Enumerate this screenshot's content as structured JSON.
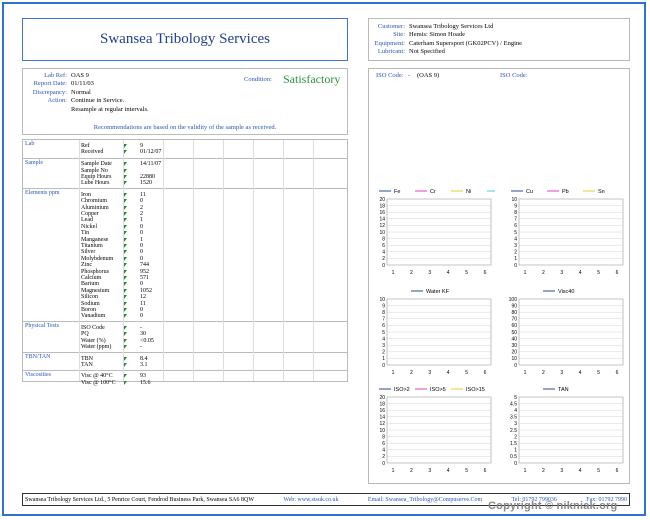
{
  "header": {
    "title": "Swansea Tribology Services"
  },
  "customer_info": [
    {
      "key": "Customer:",
      "value": "Swansea Tribology Services Ltd"
    },
    {
      "key": "Site:",
      "value": "Hemis: Simon Hoade"
    },
    {
      "key": "Equipment:",
      "value": "Caterham Supersport (GK02PCV) / Engine"
    },
    {
      "key": "Lubricant:",
      "value": "Not Specified"
    }
  ],
  "report": {
    "fields": [
      {
        "key": "Lab Ref:",
        "value": "OAS 9"
      },
      {
        "key": "Report Date:",
        "value": "01/11/03"
      },
      {
        "key": "Discrepancy:",
        "value": "Normal"
      },
      {
        "key": "Action:",
        "value": "Continue in Service."
      },
      {
        "key": "",
        "value": "Resample at regular intervals."
      }
    ],
    "condition_label": "Condition:",
    "condition_value": "Satisfactory",
    "recommendation_note": "Recommendations are based on the validity of the sample as received."
  },
  "sections": [
    {
      "label": "Lab",
      "rows": [
        [
          "Ref",
          "9"
        ],
        [
          "Received",
          "01/12/07"
        ]
      ]
    },
    {
      "label": "Sample",
      "rows": [
        [
          "Sample Date",
          "14/11/07"
        ],
        [
          "Sample No",
          ""
        ],
        [
          "Equip Hours",
          "22880"
        ],
        [
          "Lube Hours",
          "1520"
        ]
      ]
    },
    {
      "label": "Elements ppm",
      "rows": [
        [
          "Iron",
          "11"
        ],
        [
          "Chromium",
          "0"
        ],
        [
          "Aluminium",
          "2"
        ],
        [
          "Copper",
          "2"
        ],
        [
          "Lead",
          "1"
        ],
        [
          "Nickel",
          "0"
        ],
        [
          "Tin",
          "0"
        ],
        [
          "Manganese",
          "1"
        ],
        [
          "Titanium",
          "0"
        ],
        [
          "Silver",
          "0"
        ],
        [
          "Molybdenum",
          "0"
        ],
        [
          "Zinc",
          "744"
        ],
        [
          "Phosphorus",
          "952"
        ],
        [
          "Calcium",
          "571"
        ],
        [
          "Barium",
          "0"
        ],
        [
          "Magnesium",
          "1052"
        ],
        [
          "Silicon",
          "12"
        ],
        [
          "Sodium",
          "11"
        ],
        [
          "Boron",
          "0"
        ],
        [
          "Vanadium",
          "0"
        ]
      ]
    },
    {
      "label": "Physical Tests",
      "rows": [
        [
          "ISO Code",
          "-"
        ],
        [
          "PQ",
          "30"
        ],
        [
          "Water (%)",
          "<0.05"
        ],
        [
          "Water (ppm)",
          "-"
        ]
      ]
    },
    {
      "label": "TBN/TAN",
      "rows": [
        [
          "TBN",
          "8.4"
        ],
        [
          "TAN",
          "3.1"
        ]
      ]
    },
    {
      "label": "Viscosities",
      "rows": [
        [
          "Visc @ 40°C",
          "93"
        ],
        [
          "Visc @ 100°C",
          "15.6"
        ]
      ]
    }
  ],
  "iso_codes": [
    {
      "label": "ISO Code:",
      "value": "-",
      "extra": "(OAS 9)"
    },
    {
      "label": "ISO Code:",
      "value": "",
      "extra": ""
    }
  ],
  "colors": {
    "fe": "#2b4a9c",
    "cr": "#e23fd0",
    "ni": "#e0d030",
    "si": "#3fd0e0",
    "cu": "#2b4a9c",
    "pb": "#e23fd0",
    "sn": "#e0d030",
    "water": "#2b4a9c",
    "visc": "#2b4a9c",
    "iso2": "#2b4a9c",
    "iso5": "#e23fd0",
    "iso15": "#e0d030",
    "tan": "#2b4a9c"
  },
  "chart_data": [
    {
      "type": "line",
      "series": [
        {
          "name": "Fe",
          "values": []
        },
        {
          "name": "Cr",
          "values": []
        },
        {
          "name": "Ni",
          "values": []
        },
        {
          "name": "Si",
          "values": []
        }
      ],
      "x": [
        1,
        2,
        3,
        4,
        5,
        6
      ],
      "ylim": [
        0,
        20
      ],
      "yticks": [
        0,
        2,
        4,
        6,
        8,
        10,
        12,
        14,
        16,
        18,
        20
      ]
    },
    {
      "type": "line",
      "series": [
        {
          "name": "Cu",
          "values": []
        },
        {
          "name": "Pb",
          "values": []
        },
        {
          "name": "Sn",
          "values": []
        }
      ],
      "x": [
        1,
        2,
        3,
        4,
        5,
        6
      ],
      "ylim": [
        0,
        10
      ],
      "yticks": [
        0,
        1,
        2,
        3,
        4,
        5,
        6,
        7,
        8,
        9,
        10
      ]
    },
    {
      "type": "line",
      "series": [
        {
          "name": "Water KF",
          "values": []
        }
      ],
      "x": [
        1,
        2,
        3,
        4,
        5,
        6
      ],
      "ylim": [
        0,
        10
      ],
      "yticks": [
        0,
        1,
        2,
        3,
        4,
        5,
        6,
        7,
        8,
        9,
        10
      ]
    },
    {
      "type": "line",
      "series": [
        {
          "name": "Visc40",
          "values": []
        }
      ],
      "x": [
        1,
        2,
        3,
        4,
        5,
        6
      ],
      "ylim": [
        0,
        100
      ],
      "yticks": [
        0,
        10,
        20,
        30,
        40,
        50,
        60,
        70,
        80,
        90,
        100
      ]
    },
    {
      "type": "line",
      "series": [
        {
          "name": "ISO>2",
          "values": []
        },
        {
          "name": "ISO>5",
          "values": []
        },
        {
          "name": "ISO>15",
          "values": []
        }
      ],
      "x": [
        1,
        2,
        3,
        4,
        5,
        6
      ],
      "ylim": [
        0,
        20
      ],
      "yticks": [
        0,
        2,
        4,
        6,
        8,
        10,
        12,
        14,
        16,
        18,
        20
      ]
    },
    {
      "type": "line",
      "series": [
        {
          "name": "TAN",
          "values": []
        }
      ],
      "x": [
        1,
        2,
        3,
        4,
        5,
        6
      ],
      "ylim": [
        0,
        5
      ],
      "yticks": [
        0,
        0.5,
        1,
        1.5,
        2,
        2.5,
        3,
        3.5,
        4,
        4.5,
        5
      ]
    }
  ],
  "footer": {
    "address": "Swansea Tribology Services Ltd., 5 Penrice Court, Fendrod Business Park, Swansea SA6 8QW",
    "web": "Web: www.stsuk.co.uk",
    "email": "Email: Swansea_Tribology@Compuserve.Com",
    "tel": "Tel: 01792 799036",
    "fax": "Fax: 01792 7990"
  },
  "watermark": "Copyright © nikniak.org"
}
